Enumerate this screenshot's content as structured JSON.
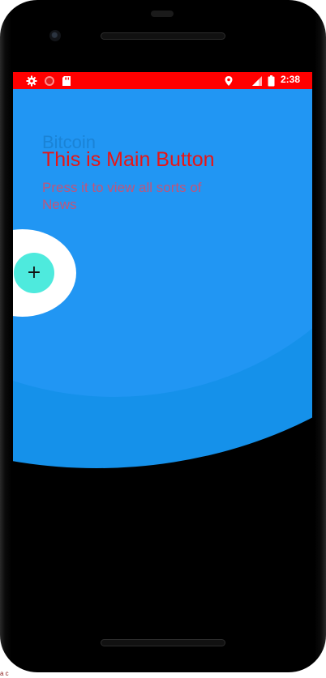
{
  "status_bar": {
    "time": "2:38",
    "left_icons": [
      "gear-icon",
      "record-icon",
      "sd-card-icon"
    ],
    "right_icons": [
      "location-pin-icon",
      "signal-icon",
      "battery-icon"
    ],
    "background": "#ff0000"
  },
  "background_content": {
    "title": "Bitcoin"
  },
  "tap_target": {
    "title": "This is Main Button",
    "description": "Press it to view all sorts of News",
    "outer_color": "#1591ea",
    "inner_color": "#2196f3",
    "title_color": "#e81515",
    "description_color": "#c1557a"
  },
  "fab": {
    "icon": "plus-icon",
    "symbol": "+",
    "color": "#4eeadd"
  },
  "corner_text": "a c"
}
